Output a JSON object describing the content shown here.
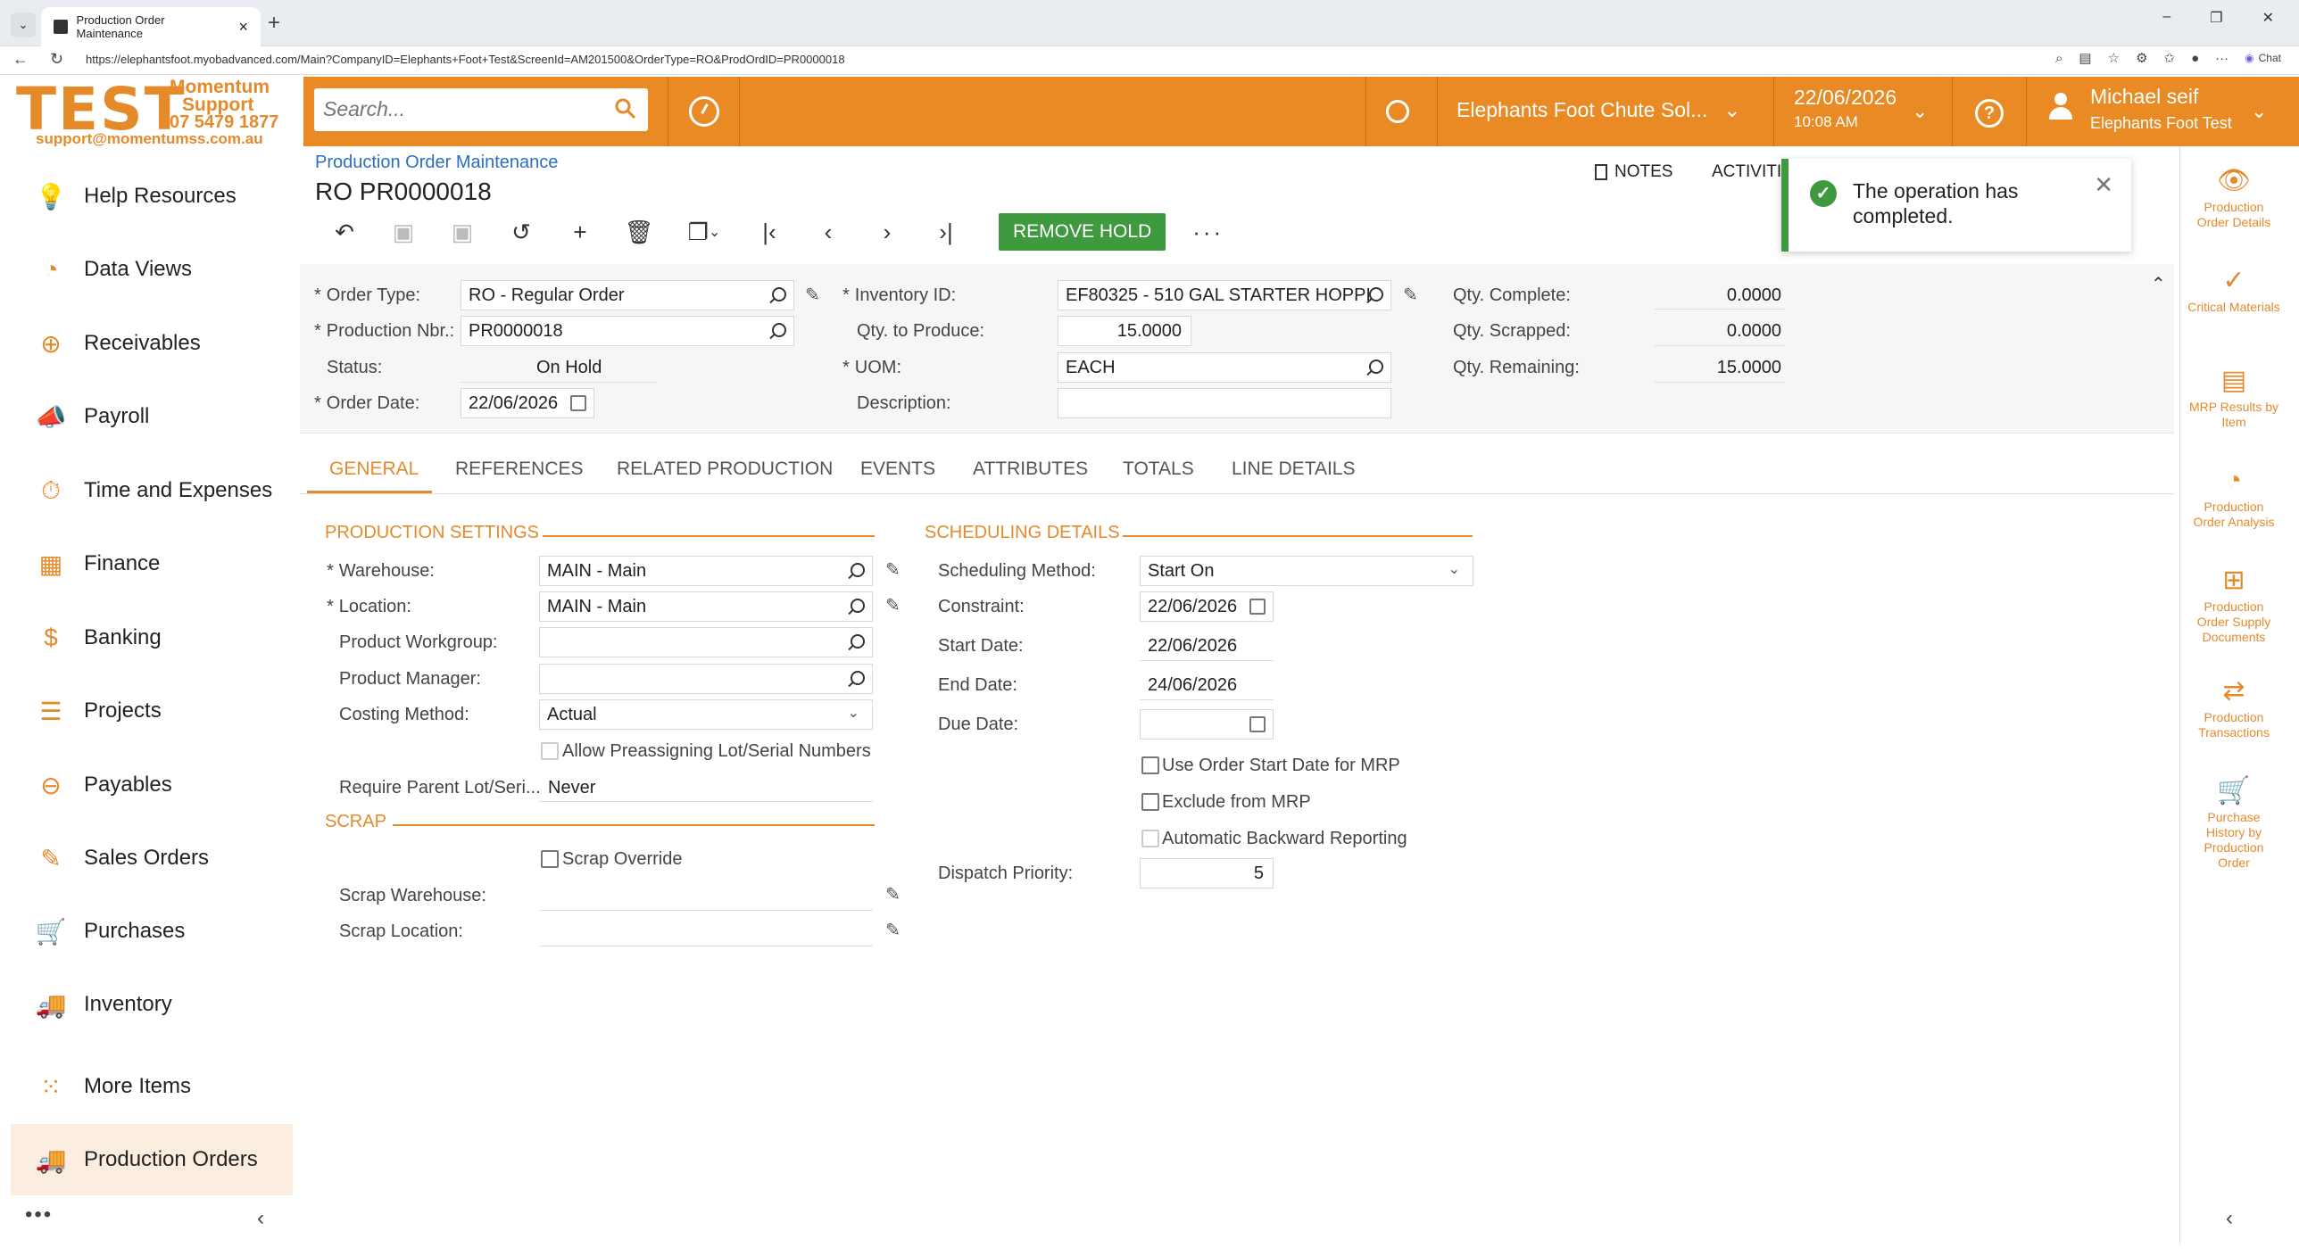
{
  "browser": {
    "tab_title": "Production Order Maintenance",
    "url": "https://elephantsfoot.myobadvanced.com/Main?CompanyID=Elephants+Foot+Test&ScreenId=AM201500&OrderType=RO&ProdOrdID=PR0000018",
    "chat_label": "Chat"
  },
  "logo": {
    "big": "TEST",
    "line1": "Momentum",
    "line2": "Support",
    "line3": "07 5479 1877",
    "line4": "support@momentumss.com.au"
  },
  "topbar": {
    "search_placeholder": "Search...",
    "company": "Elephants Foot Chute Sol...",
    "date": "22/06/2026",
    "time": "10:08 AM",
    "help": "?",
    "user_name": "Michael seif",
    "user_company": "Elephants Foot Test"
  },
  "leftnav": {
    "items": [
      {
        "label": "Help Resources",
        "icon": "lightbulb-icon"
      },
      {
        "label": "Data Views",
        "icon": "pie-chart-icon"
      },
      {
        "label": "Receivables",
        "icon": "plus-circle-icon"
      },
      {
        "label": "Payroll",
        "icon": "megaphone-icon"
      },
      {
        "label": "Time and Expenses",
        "icon": "stopwatch-icon"
      },
      {
        "label": "Finance",
        "icon": "calculator-icon"
      },
      {
        "label": "Banking",
        "icon": "dollar-icon"
      },
      {
        "label": "Projects",
        "icon": "projects-icon"
      },
      {
        "label": "Payables",
        "icon": "minus-circle-icon"
      },
      {
        "label": "Sales Orders",
        "icon": "pencil-square-icon"
      },
      {
        "label": "Purchases",
        "icon": "cart-icon"
      },
      {
        "label": "Inventory",
        "icon": "truck-icon"
      },
      {
        "label": "More Items",
        "icon": "grid-dots-icon"
      },
      {
        "label": "Production Orders",
        "icon": "truck-icon"
      }
    ],
    "footer": "•••",
    "collapse": "‹"
  },
  "rightbar": {
    "items": [
      {
        "label": "Production Order Details",
        "icon": "eye-icon"
      },
      {
        "label": "Critical Materials",
        "icon": "check-circle-icon"
      },
      {
        "label": "MRP Results by Item",
        "icon": "document-icon"
      },
      {
        "label": "Production Order Analysis",
        "icon": "gauge-icon"
      },
      {
        "label": "Production Order Supply Documents",
        "icon": "hierarchy-icon"
      },
      {
        "label": "Production Transactions",
        "icon": "swap-icon"
      },
      {
        "label": "Purchase History by Production Order",
        "icon": "cart-icon"
      }
    ],
    "collapse": "‹"
  },
  "page": {
    "breadcrumb": "Production Order Maintenance",
    "title": "RO PR0000018",
    "notes": "NOTES",
    "activities": "ACTIVITIES",
    "remove_hold": "REMOVE HOLD",
    "more": "···"
  },
  "toast": {
    "message": "The operation has completed.",
    "close": "✕"
  },
  "header": {
    "order_type_label": "Order Type:",
    "order_type": "RO - Regular Order",
    "production_nbr_label": "Production Nbr.:",
    "production_nbr": "PR0000018",
    "status_label": "Status:",
    "status": "On Hold",
    "order_date_label": "Order Date:",
    "order_date": "22/06/2026",
    "inventory_id_label": "Inventory ID:",
    "inventory_id": "EF80325 - 510 GAL STARTER HOPPI",
    "qty_to_produce_label": "Qty. to Produce:",
    "qty_to_produce": "15.0000",
    "uom_label": "UOM:",
    "uom": "EACH",
    "description_label": "Description:",
    "description": "",
    "qty_complete_label": "Qty. Complete:",
    "qty_complete": "0.0000",
    "qty_scrapped_label": "Qty. Scrapped:",
    "qty_scrapped": "0.0000",
    "qty_remaining_label": "Qty. Remaining:",
    "qty_remaining": "15.0000"
  },
  "tabs": [
    "GENERAL",
    "REFERENCES",
    "RELATED PRODUCTION",
    "EVENTS",
    "ATTRIBUTES",
    "TOTALS",
    "LINE DETAILS"
  ],
  "general": {
    "production_settings_title": "PRODUCTION SETTINGS",
    "warehouse_label": "Warehouse:",
    "warehouse": "MAIN - Main",
    "location_label": "Location:",
    "location": "MAIN - Main",
    "product_workgroup_label": "Product Workgroup:",
    "product_workgroup": "",
    "product_manager_label": "Product Manager:",
    "product_manager": "",
    "costing_method_label": "Costing Method:",
    "costing_method": "Actual",
    "allow_preassign_label": "Allow Preassigning Lot/Serial Numbers",
    "require_parent_label": "Require Parent Lot/Seri...",
    "require_parent": "Never",
    "scrap_title": "SCRAP",
    "scrap_override_label": "Scrap Override",
    "scrap_warehouse_label": "Scrap Warehouse:",
    "scrap_location_label": "Scrap Location:",
    "scheduling_title": "SCHEDULING DETAILS",
    "scheduling_method_label": "Scheduling Method:",
    "scheduling_method": "Start On",
    "constraint_label": "Constraint:",
    "constraint": "22/06/2026",
    "start_date_label": "Start Date:",
    "start_date": "22/06/2026",
    "end_date_label": "End Date:",
    "end_date": "24/06/2026",
    "due_date_label": "Due Date:",
    "due_date": "",
    "use_order_start_label": "Use Order Start Date for MRP",
    "exclude_mrp_label": "Exclude from MRP",
    "auto_backward_label": "Automatic Backward Reporting",
    "dispatch_priority_label": "Dispatch Priority:",
    "dispatch_priority": "5"
  }
}
